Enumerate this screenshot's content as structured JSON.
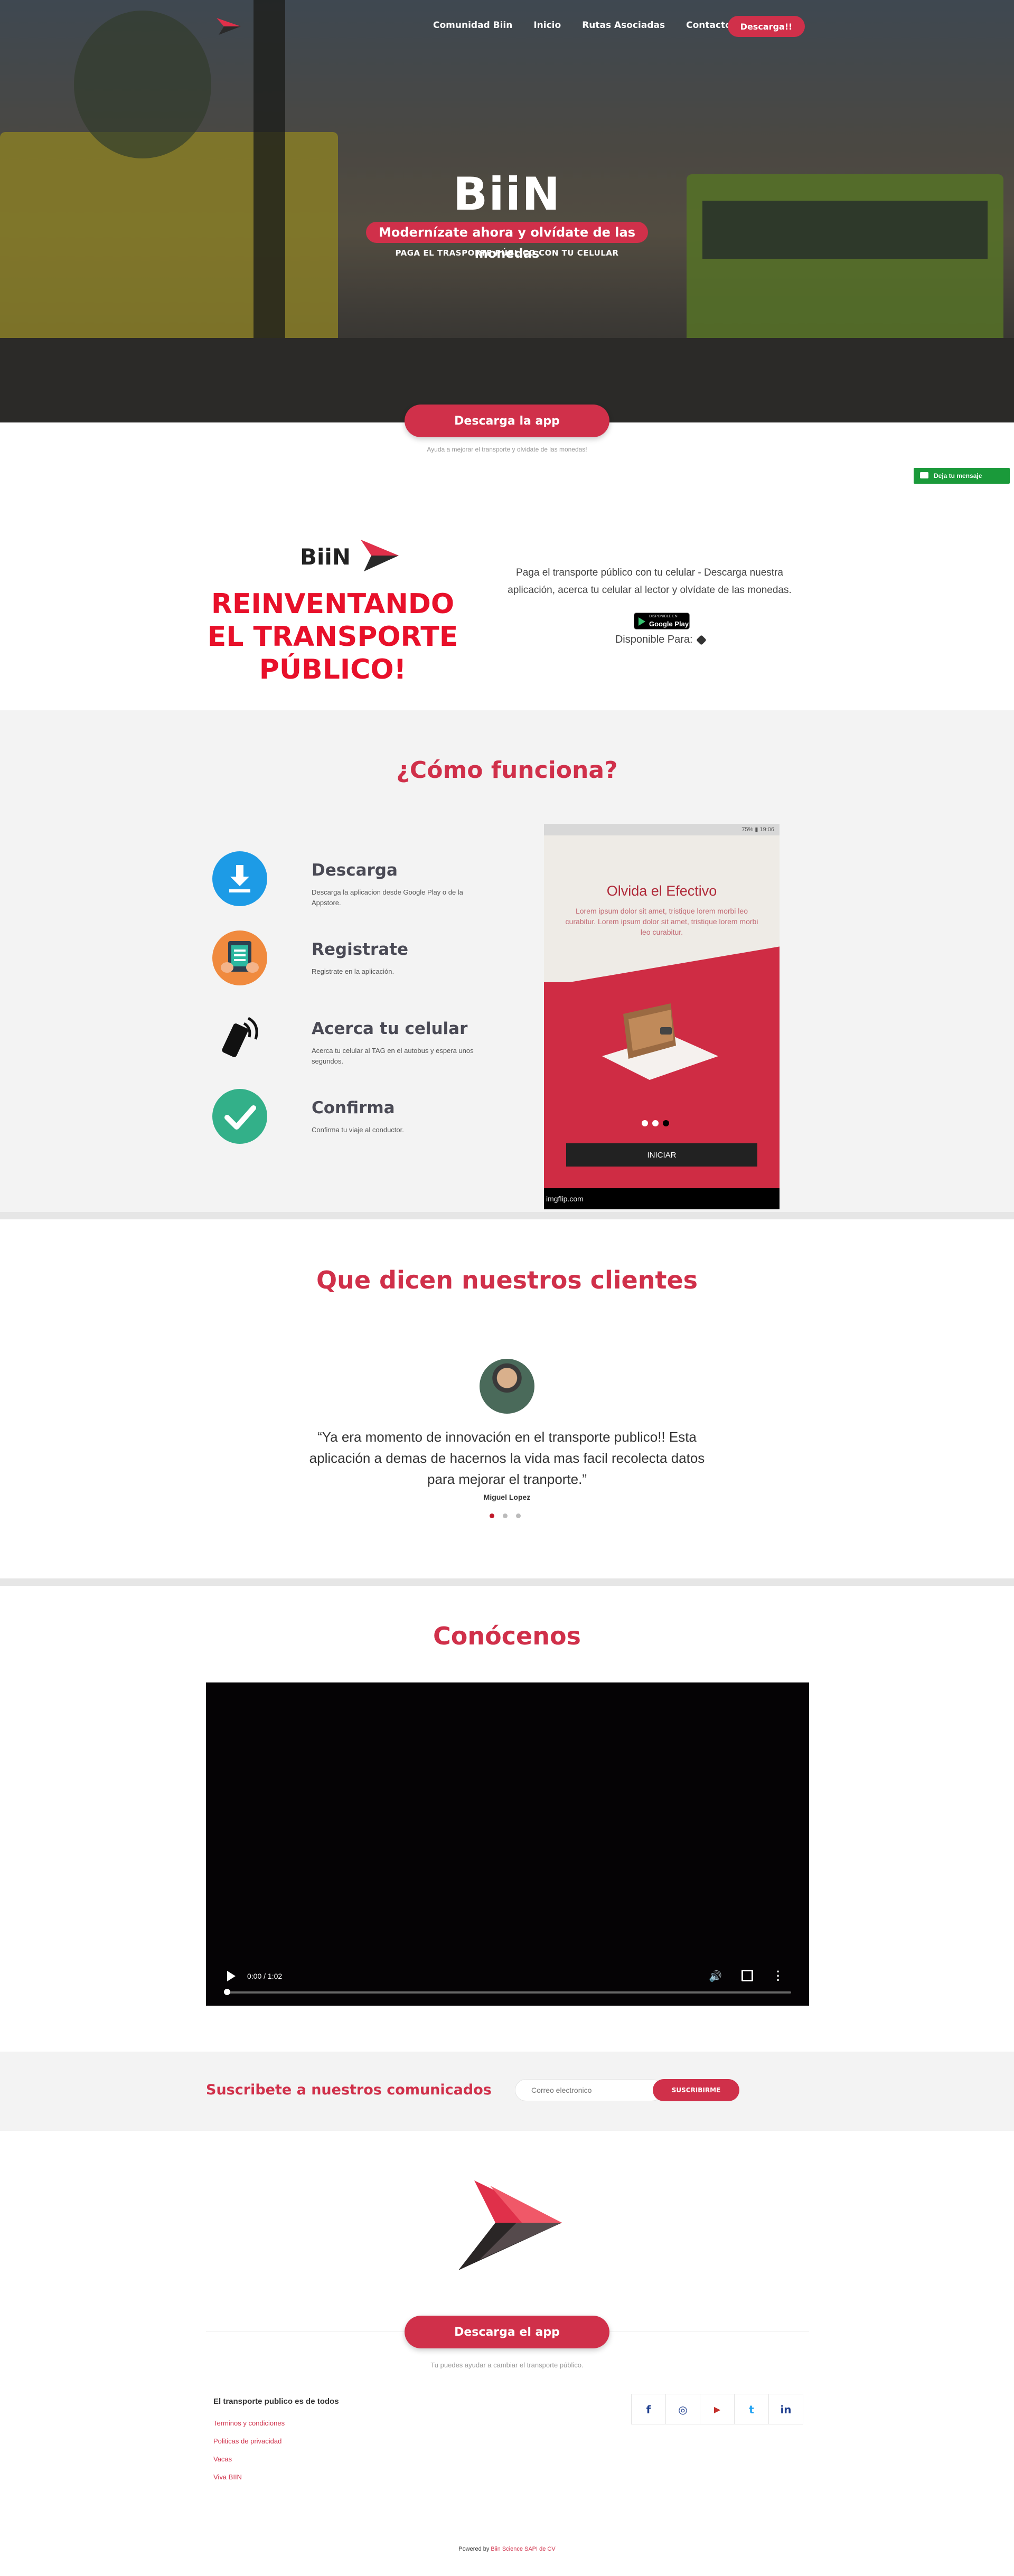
{
  "nav": {
    "items": [
      {
        "label": "Comunidad Biin"
      },
      {
        "label": "Inicio"
      },
      {
        "label": "Rutas Asociadas"
      },
      {
        "label": "Contacto"
      }
    ],
    "cta_label": "Descarga!!"
  },
  "hero": {
    "title": "BiiN",
    "badge": "Modernízate ahora y olvídate de las monedas",
    "subtitle": "PAGA EL TRASPORTE PÚBLICO CON TU CELULAR"
  },
  "download": {
    "button_label": "Descarga la app",
    "note": "Ayuda a mejorar el transporte y olvidate de las monedas!"
  },
  "message_tab": {
    "label": "Deja tu mensaje"
  },
  "intro": {
    "logo_text": "BiiN",
    "headline": "REINVENTANDO EL TRANSPORTE PÚBLICO!",
    "description": "Paga el transporte público con tu celular - Descarga nuestra aplicación, acerca tu celular al lector y olvídate de las monedas.",
    "store_badge_small": "DISPONIBLE EN",
    "store_badge_name": "Google Play",
    "available_label": "Disponible Para:"
  },
  "how": {
    "title": "¿Cómo funciona?",
    "steps": [
      {
        "title": "Descarga",
        "desc": "Descarga la aplicacion desde Google Play o de la Appstore.",
        "icon": "download-icon"
      },
      {
        "title": "Registrate",
        "desc": "Registrate en la aplicación.",
        "icon": "register-icon"
      },
      {
        "title": "Acerca tu celular",
        "desc": "Acerca tu celular al TAG en el autobus y espera unos segundos.",
        "icon": "tap-phone-icon"
      },
      {
        "title": "Confirma",
        "desc": "Confirma tu viaje al conductor.",
        "icon": "check-icon"
      }
    ],
    "phone": {
      "status": "75% ▮ 19:06",
      "heading": "Olvida el Efectivo",
      "lorem": "Lorem ipsum dolor sit amet, tristique lorem morbi leo curabitur. Lorem ipsum dolor sit amet, tristique lorem morbi leo curabitur.",
      "start_label": "INICIAR",
      "watermark": "imgflip.com"
    }
  },
  "testimonials": {
    "title": "Que dicen nuestros clientes",
    "quote": "“Ya era momento de innovación en el transporte publico!! Esta aplicación a demas de hacernos la vida mas facil recolecta datos para mejorar el tranporte.”",
    "author": "Miguel Lopez"
  },
  "know": {
    "title": "Conócenos",
    "video_time": "0:00 / 1:02"
  },
  "newsletter": {
    "label": "Suscribete a nuestros comunicados",
    "placeholder": "Correo electronico",
    "button_label": "SUSCRIBIRME"
  },
  "footer": {
    "button_label": "Descarga el app",
    "note": "Tu puedes ayudar a cambiar el transporte público.",
    "headline": "El transporte publico es de todos",
    "links": [
      {
        "label": "Terminos y condiciones"
      },
      {
        "label": "Politicas de privacidad"
      },
      {
        "label": "Vacas"
      },
      {
        "label": "Viva BIIN"
      }
    ],
    "social": [
      {
        "glyph": "f",
        "icon": "facebook-icon"
      },
      {
        "glyph": "◎",
        "icon": "instagram-icon"
      },
      {
        "glyph": "▶",
        "icon": "youtube-icon"
      },
      {
        "glyph": "t",
        "icon": "twitter-icon"
      },
      {
        "glyph": "in",
        "icon": "linkedin-icon"
      }
    ],
    "powered_prefix": "Powered by",
    "powered_brand": "Biin Science SAPI de CV"
  },
  "colors": {
    "brand_red": "#d0304a",
    "headline_red": "#e8102a",
    "green": "#1a9a3a"
  }
}
